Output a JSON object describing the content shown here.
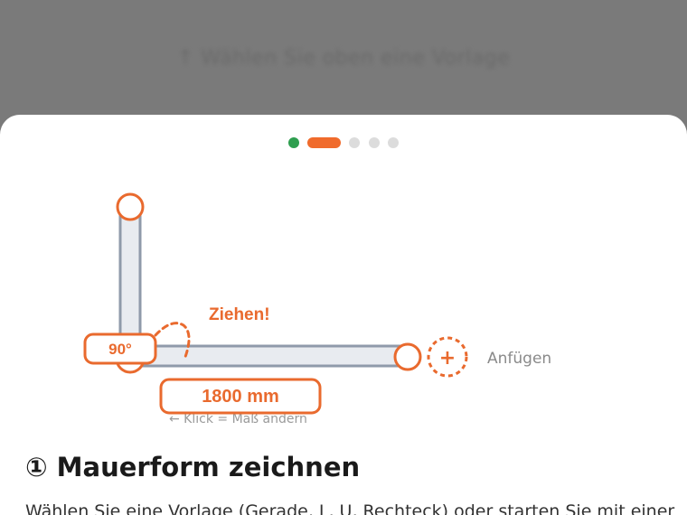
{
  "backdrop": {
    "hint": "↑ Wählen Sie oben eine Vorlage"
  },
  "onboarding": {
    "steps": [
      {
        "state": "done",
        "color": "#2e9e4f"
      },
      {
        "state": "active",
        "color": "#f06b2c"
      },
      {
        "state": "pending",
        "color": "#dcdcdc"
      },
      {
        "state": "pending",
        "color": "#dcdcdc"
      },
      {
        "state": "pending",
        "color": "#dcdcdc"
      }
    ],
    "current_step": 2,
    "total_steps": 5
  },
  "diagram": {
    "drag_label": "Ziehen!",
    "angle_label": "90°",
    "length_label": "1800 mm",
    "click_hint": "← Klick = Maß ändern",
    "add_label": "Anfügen",
    "add_symbol": "+",
    "accent_color": "#e96a2e",
    "wall_fill": "#e8ebf0",
    "wall_stroke": "#8f9aaa"
  },
  "step": {
    "title": "① Mauerform zeichnen",
    "description": "Wählen Sie eine Vorlage (Gerade, L, U, Rechteck) oder starten Sie mit einer"
  }
}
